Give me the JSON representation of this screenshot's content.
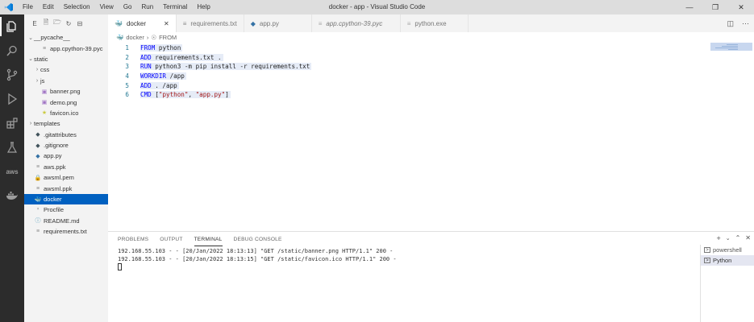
{
  "window": {
    "title": "docker - app - Visual Studio Code",
    "menu": [
      "File",
      "Edit",
      "Selection",
      "View",
      "Go",
      "Run",
      "Terminal",
      "Help"
    ]
  },
  "activity_bar": [
    "files-icon",
    "search-icon",
    "source-control-icon",
    "run-debug-icon",
    "extensions-icon",
    "testing-icon",
    "aws-icon",
    "docker-icon"
  ],
  "activity_bar_aws_label": "aws",
  "sidebar": {
    "toolbar_letter": "E",
    "items": [
      {
        "label": "__pycache__",
        "kind": "folder-open",
        "indent": 1
      },
      {
        "label": "app.cpython-39.pyc",
        "kind": "file",
        "indent": 2
      },
      {
        "label": "static",
        "kind": "folder-open",
        "indent": 1
      },
      {
        "label": "css",
        "kind": "folder",
        "indent": 2
      },
      {
        "label": "js",
        "kind": "folder",
        "indent": 2
      },
      {
        "label": "banner.png",
        "kind": "image",
        "indent": 2
      },
      {
        "label": "demo.png",
        "kind": "image",
        "indent": 2
      },
      {
        "label": "favicon.ico",
        "kind": "favicon",
        "indent": 2
      },
      {
        "label": "templates",
        "kind": "folder",
        "indent": 1
      },
      {
        "label": ".gitattributes",
        "kind": "git",
        "indent": 1
      },
      {
        "label": ".gitignore",
        "kind": "git",
        "indent": 1
      },
      {
        "label": "app.py",
        "kind": "python",
        "indent": 1
      },
      {
        "label": "aws.ppk",
        "kind": "file",
        "indent": 1
      },
      {
        "label": "awsml.pem",
        "kind": "lock",
        "indent": 1
      },
      {
        "label": "awsml.ppk",
        "kind": "file",
        "indent": 1
      },
      {
        "label": "docker",
        "kind": "docker",
        "indent": 1,
        "selected": true
      },
      {
        "label": "Procfile",
        "kind": "procfile",
        "indent": 1
      },
      {
        "label": "README.md",
        "kind": "info",
        "indent": 1
      },
      {
        "label": "requirements.txt",
        "kind": "file",
        "indent": 1
      }
    ]
  },
  "tabs": [
    {
      "label": "docker",
      "icon": "docker-icon",
      "active": true,
      "italic": false
    },
    {
      "label": "requirements.txt",
      "icon": "text-file-icon",
      "active": false,
      "italic": false
    },
    {
      "label": "app.py",
      "icon": "python-file-icon",
      "active": false,
      "italic": false
    },
    {
      "label": "app.cpython-39.pyc",
      "icon": "file-icon",
      "active": false,
      "italic": true
    },
    {
      "label": "python.exe",
      "icon": "file-icon",
      "active": false,
      "italic": false
    }
  ],
  "breadcrumb": {
    "file": "docker",
    "symbol": "FROM"
  },
  "editor": {
    "lines": [
      {
        "num": "1",
        "kw": "FROM",
        "text": " python",
        "str": ""
      },
      {
        "num": "2",
        "kw": "ADD",
        "text": " requirements.txt .",
        "str": ""
      },
      {
        "num": "3",
        "kw": "RUN",
        "text": " python3 -m pip install -r requirements.txt",
        "str": ""
      },
      {
        "num": "4",
        "kw": "WORKDIR",
        "text": " /app",
        "str": ""
      },
      {
        "num": "5",
        "kw": "ADD",
        "text": " . /app",
        "str": ""
      },
      {
        "num": "6",
        "kw": "CMD",
        "text": " [",
        "str": "\"python\"",
        "text2": ", ",
        "str2": "\"app.py\"",
        "text3": "]"
      }
    ]
  },
  "panel": {
    "tabs": [
      "PROBLEMS",
      "OUTPUT",
      "TERMINAL",
      "DEBUG CONSOLE"
    ],
    "active_tab": "TERMINAL",
    "terminal_lines": [
      "192.168.55.103 - - [20/Jan/2022 18:13:13] \"GET /static/banner.png HTTP/1.1\" 200 -",
      "192.168.55.103 - - [20/Jan/2022 18:13:15] \"GET /static/favicon.ico HTTP/1.1\" 200 -"
    ],
    "terminals": [
      {
        "label": "powershell",
        "selected": false
      },
      {
        "label": "Python",
        "selected": true
      }
    ]
  }
}
